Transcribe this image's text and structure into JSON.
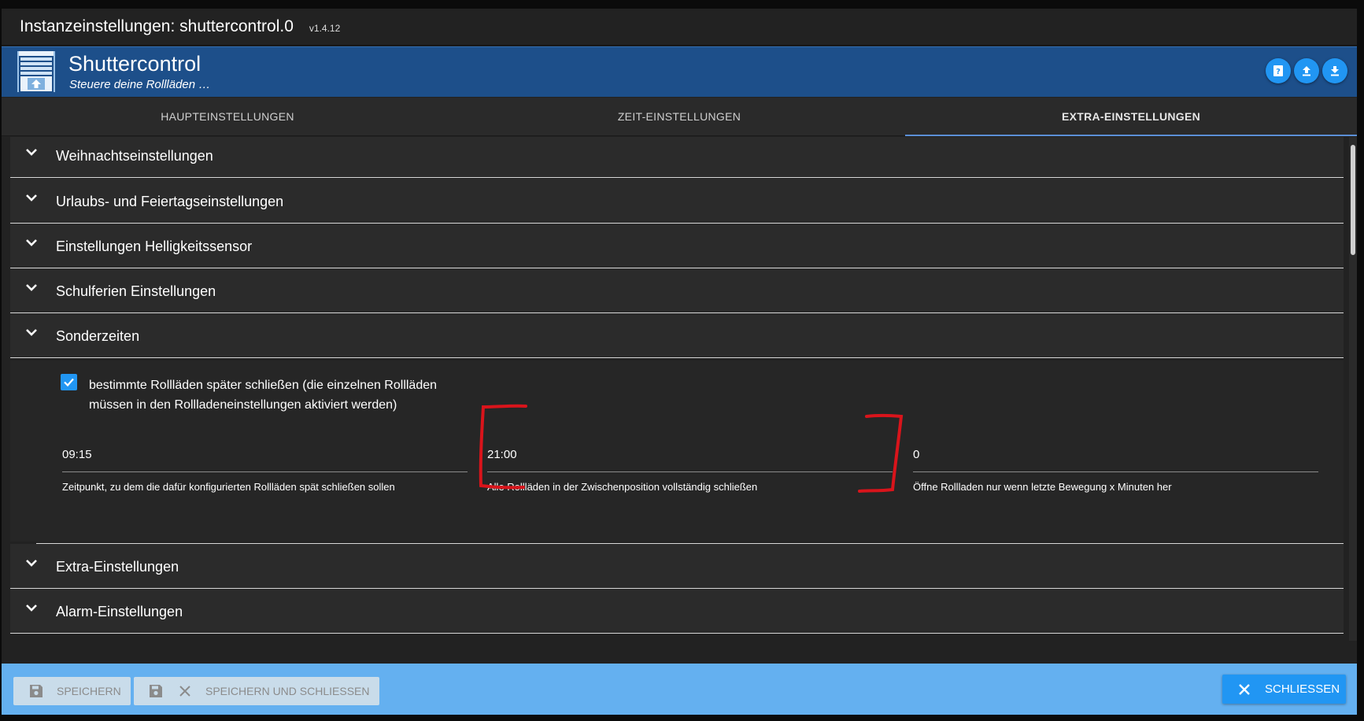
{
  "window": {
    "title": "Instanzeinstellungen: shuttercontrol.0",
    "version": "v1.4.12"
  },
  "header": {
    "app_name": "Shuttercontrol",
    "subtitle": "Steuere deine Rollläden …"
  },
  "tabs": [
    {
      "label": "HAUPTEINSTELLUNGEN",
      "active": false
    },
    {
      "label": "ZEIT-EINSTELLUNGEN",
      "active": false
    },
    {
      "label": "EXTRA-EINSTELLUNGEN",
      "active": true
    }
  ],
  "panels": [
    {
      "title": "Weihnachtseinstellungen"
    },
    {
      "title": "Urlaubs- und Feiertagseinstellungen"
    },
    {
      "title": "Einstellungen Helligkeitssensor"
    },
    {
      "title": "Schulferien Einstellungen"
    },
    {
      "title": "Sonderzeiten"
    },
    {
      "title": "Extra-Einstellungen"
    },
    {
      "title": "Alarm-Einstellungen"
    }
  ],
  "sonderzeiten": {
    "checkbox_checked": true,
    "checkbox_label_line1": "bestimmte Rollläden später schließen (die einzelnen Rollläden",
    "checkbox_label_line2": "müssen in den Rollladeneinstellungen aktiviert werden)",
    "fields": [
      {
        "value": "09:15",
        "hint": "Zeitpunkt, zu dem die dafür konfigurierten Rollläden spät schließen sollen"
      },
      {
        "value": "21:00",
        "hint": "Alle Rollläden in der Zwischenposition vollständig schließen"
      },
      {
        "value": "0",
        "hint": "Öffne Rollladen nur wenn letzte Bewegung x Minuten her"
      }
    ]
  },
  "footer": {
    "save_label": "SPEICHERN",
    "save_close_label": "SPEICHERN UND SCHLIESSEN",
    "close_label": "SCHLIESSEN"
  },
  "colors": {
    "header_bg": "#1d4f8a",
    "accent": "#2196f3",
    "footer_bg": "#64b0f0",
    "annotation": "#d9141b"
  }
}
